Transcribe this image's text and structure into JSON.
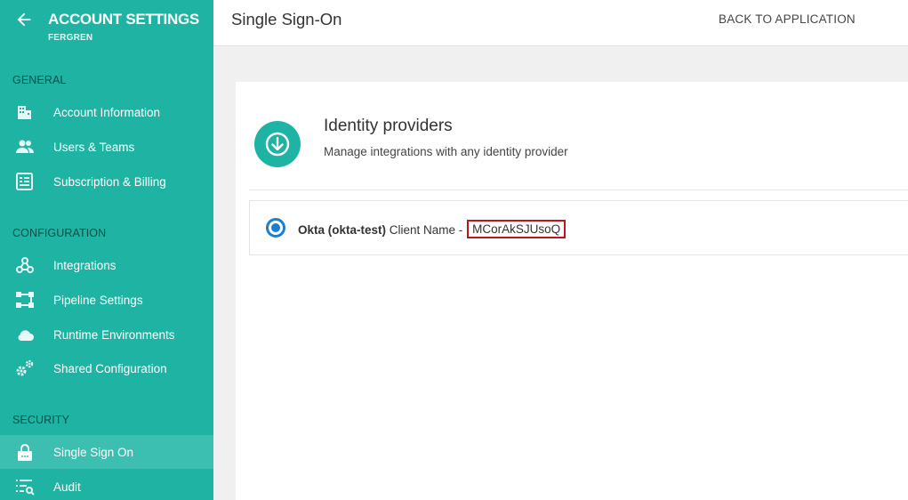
{
  "sidebar": {
    "title": "ACCOUNT SETTINGS",
    "subtitle": "FERGREN",
    "sections": {
      "general": "GENERAL",
      "configuration": "CONFIGURATION",
      "security": "SECURITY"
    },
    "items": {
      "account_information": "Account Information",
      "users_teams": "Users & Teams",
      "subscription_billing": "Subscription & Billing",
      "integrations": "Integrations",
      "pipeline_settings": "Pipeline Settings",
      "runtime_environments": "Runtime Environments",
      "shared_configuration": "Shared Configuration",
      "single_sign_on": "Single Sign On",
      "audit": "Audit"
    },
    "active_item": "single_sign_on",
    "accent_color": "#1eb3a2"
  },
  "header": {
    "title": "Single Sign-On",
    "back_link": "BACK TO APPLICATION"
  },
  "main": {
    "identity_providers": {
      "title": "Identity providers",
      "description": "Manage integrations with any identity provider",
      "icon": "download-circle-icon"
    },
    "provider": {
      "name": "Okta (okta-test)",
      "client_label": "Client Name -",
      "client_value": "MCorAkSJUsoQ",
      "selected": true
    }
  }
}
